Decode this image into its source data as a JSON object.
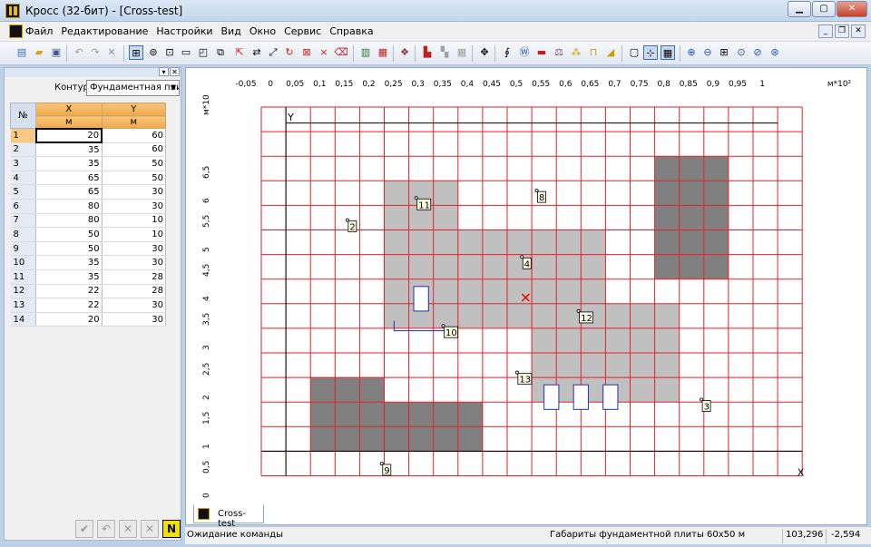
{
  "window": {
    "title": "Кросс (32-бит) - [Cross-test]"
  },
  "menu": [
    "Файл",
    "Редактирование",
    "Настройки",
    "Вид",
    "Окно",
    "Сервис",
    "Справка"
  ],
  "left_panel": {
    "contour_label": "Контур",
    "contour_value": "Фундаментная плит",
    "columns": {
      "num": "№",
      "x": "X",
      "y": "Y",
      "unit": "м"
    },
    "rows": [
      {
        "n": "1",
        "x": "20",
        "y": "60"
      },
      {
        "n": "2",
        "x": "35",
        "y": "60"
      },
      {
        "n": "3",
        "x": "35",
        "y": "50"
      },
      {
        "n": "4",
        "x": "65",
        "y": "50"
      },
      {
        "n": "5",
        "x": "65",
        "y": "30"
      },
      {
        "n": "6",
        "x": "80",
        "y": "30"
      },
      {
        "n": "7",
        "x": "80",
        "y": "10"
      },
      {
        "n": "8",
        "x": "50",
        "y": "10"
      },
      {
        "n": "9",
        "x": "50",
        "y": "30"
      },
      {
        "n": "10",
        "x": "35",
        "y": "30"
      },
      {
        "n": "11",
        "x": "35",
        "y": "28"
      },
      {
        "n": "12",
        "x": "22",
        "y": "28"
      },
      {
        "n": "13",
        "x": "22",
        "y": "30"
      },
      {
        "n": "14",
        "x": "20",
        "y": "30"
      }
    ],
    "bottom_buttons": [
      "apply",
      "undo",
      "delete",
      "delete-all",
      "N"
    ]
  },
  "cad": {
    "x_ticks": [
      "-0,05",
      "0",
      "0,05",
      "0,1",
      "0,15",
      "0,2",
      "0,25",
      "0,3",
      "0,35",
      "0,4",
      "0,45",
      "0,5",
      "0,55",
      "0,6",
      "0,65",
      "0,7",
      "0,75",
      "0,8",
      "0,85",
      "0,9",
      "0,95",
      "1"
    ],
    "x_unit": "м*10²",
    "y_ticks": [
      "0",
      "0,5",
      "1",
      "1,5",
      "2",
      "2,5",
      "3",
      "3,5",
      "4",
      "4,5",
      "5",
      "5,5",
      "6",
      "6,5"
    ],
    "y_unit": "м*10",
    "axis_x_label": "X",
    "axis_y_label": "Y",
    "markers": [
      "2",
      "3",
      "4",
      "8",
      "9",
      "10",
      "11",
      "12",
      "13"
    ],
    "tab_label": "Cross-test",
    "colors": {
      "grid": "#e2222a",
      "light": "#c0c0c0",
      "dark": "#808080",
      "outline": "#1f2fb5"
    }
  },
  "status": {
    "left": "Ожидание команды",
    "middle": "Габариты фундаментной плиты 60x50 м",
    "x": "103,296",
    "y": "-2,594"
  }
}
